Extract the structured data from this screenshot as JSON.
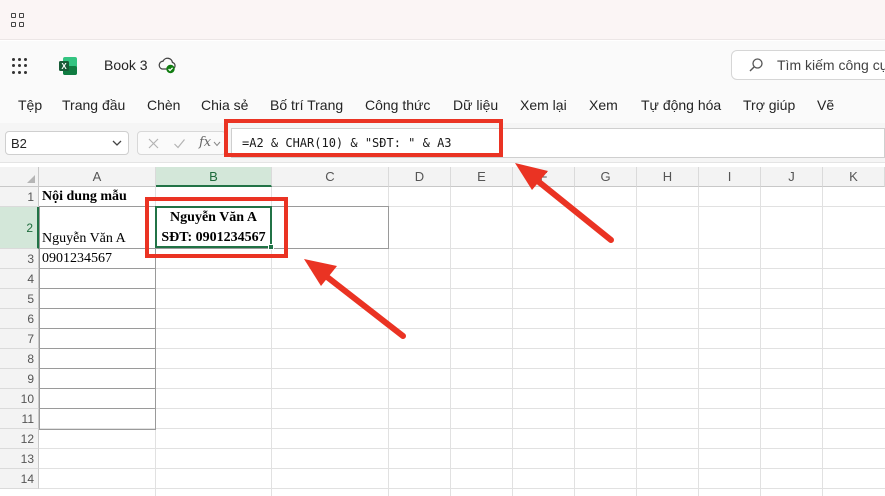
{
  "app": {
    "title": "Book 3",
    "search_placeholder": "Tìm kiếm công cụ"
  },
  "ribbon": {
    "tabs": [
      "Tệp",
      "Trang đầu",
      "Chèn",
      "Chia sẻ",
      "Bố trí Trang",
      "Công thức",
      "Dữ liệu",
      "Xem lại",
      "Xem",
      "Tự động hóa",
      "Trợ giúp",
      "Vẽ"
    ]
  },
  "formula_bar": {
    "name_box": "B2",
    "fx_label": "fx",
    "formula": "=A2 & CHAR(10) & \"SĐT: \" & A3"
  },
  "grid": {
    "columns": [
      "A",
      "B",
      "C",
      "D",
      "E",
      "F",
      "G",
      "H",
      "I",
      "J",
      "K"
    ],
    "rows": [
      "1",
      "2",
      "3",
      "4",
      "5",
      "6",
      "7",
      "8",
      "9",
      "10",
      "11",
      "12",
      "13",
      "14"
    ],
    "active_cell": "B2",
    "cells": {
      "A1": "Nội dung mẫu",
      "A2": "Nguyễn Văn A",
      "A3": "0901234567",
      "B2_line1": "Nguyễn Văn A",
      "B2_line2": "SĐT: 0901234567"
    }
  },
  "colors": {
    "accent_green": "#217346",
    "annotation_red": "#ea3323"
  }
}
